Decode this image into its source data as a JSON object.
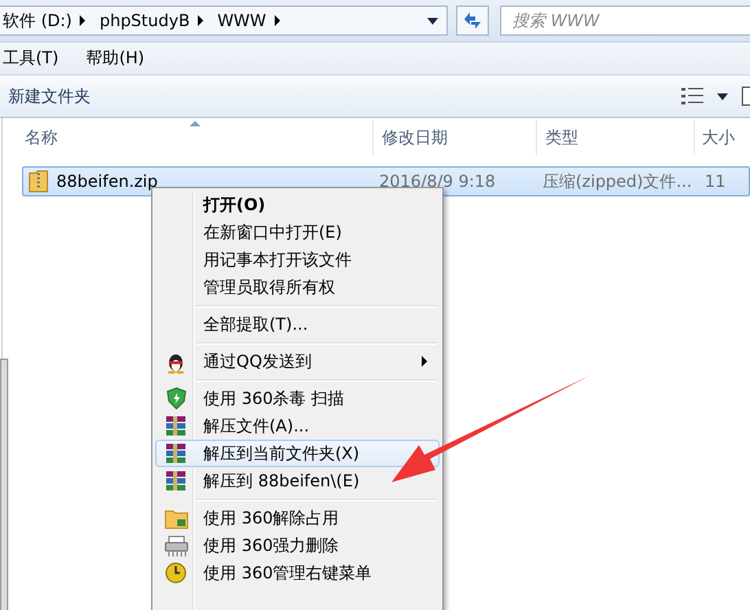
{
  "address_bar": {
    "breadcrumbs": [
      "软件 (D:)",
      "phpStudyB",
      "WWW"
    ]
  },
  "search": {
    "placeholder": "搜索 WWW"
  },
  "menu_bar": [
    "工具(T)",
    "帮助(H)"
  ],
  "toolbar": {
    "buttons": [
      "新建文件夹"
    ]
  },
  "columns": [
    "名称",
    "修改日期",
    "类型",
    "大小"
  ],
  "files": [
    {
      "name": "88beifen.zip",
      "modified": "2016/8/9 9:18",
      "type": "压缩(zipped)文件...",
      "size": "11",
      "selected": true
    }
  ],
  "context_menu": {
    "items": [
      {
        "kind": "plain",
        "label": "打开(O)",
        "default": true,
        "selected": false
      },
      {
        "kind": "plain",
        "label": "在新窗口中打开(E)",
        "default": false,
        "selected": false
      },
      {
        "kind": "plain",
        "label": "用记事本打开该文件",
        "default": false,
        "selected": false
      },
      {
        "kind": "plain",
        "label": "管理员取得所有权",
        "default": false,
        "selected": false
      },
      {
        "kind": "separator"
      },
      {
        "kind": "plain",
        "label": "全部提取(T)...",
        "default": false,
        "selected": false
      },
      {
        "kind": "separator"
      },
      {
        "kind": "qq",
        "label": "通过QQ发送到",
        "default": false,
        "selected": false,
        "submenu": true
      },
      {
        "kind": "separator"
      },
      {
        "kind": "shield",
        "label": "使用 360杀毒 扫描",
        "default": false,
        "selected": false
      },
      {
        "kind": "archive",
        "label": "解压文件(A)...",
        "default": false,
        "selected": false
      },
      {
        "kind": "archive",
        "label": "解压到当前文件夹(X)",
        "default": false,
        "selected": true
      },
      {
        "kind": "archive",
        "label": "解压到 88beifen\\(E)",
        "default": false,
        "selected": false
      },
      {
        "kind": "separator"
      },
      {
        "kind": "folder",
        "label": "使用 360解除占用",
        "default": false,
        "selected": false
      },
      {
        "kind": "shredder",
        "label": "使用 360强力删除",
        "default": false,
        "selected": false
      },
      {
        "kind": "manage",
        "label": "使用 360管理右键菜单",
        "default": false,
        "selected": false
      }
    ]
  }
}
